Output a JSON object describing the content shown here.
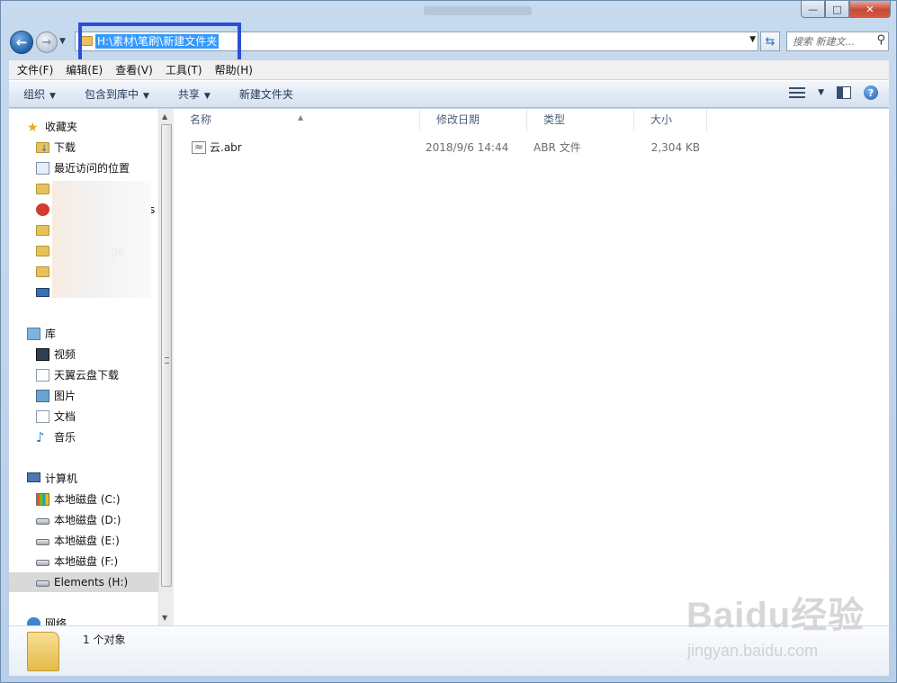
{
  "window": {
    "caption": {
      "minimize": "—",
      "maximize": "□",
      "close": "✕"
    }
  },
  "nav": {
    "back": "←",
    "forward": "→",
    "recent": "▼",
    "address": "H:\\素材\\笔刷\\新建文件夹",
    "address_dropdown": "▼",
    "refresh": "⇆",
    "search_placeholder": "搜索 新建文...",
    "search_icon": "⚲"
  },
  "menu": [
    "文件(F)",
    "编辑(E)",
    "查看(V)",
    "工具(T)",
    "帮助(H)"
  ],
  "toolbar": {
    "organize": "组织",
    "include_library": "包含到库中",
    "share": "共享",
    "new_folder": "新建文件夹",
    "dropdown_arrow": "▼",
    "help": "?"
  },
  "sidebar": {
    "favorites": "收藏夹",
    "favorites_items": [
      "下载",
      "最近访问的位置",
      "s",
      "ge"
    ],
    "libraries": "库",
    "library_items": [
      "视频",
      "天翼云盘下载",
      "图片",
      "文档",
      "音乐"
    ],
    "computer": "计算机",
    "computer_items": [
      "本地磁盘 (C:)",
      "本地磁盘 (D:)",
      "本地磁盘 (E:)",
      "本地磁盘 (F:)",
      "Elements (H:)"
    ],
    "network": "网络"
  },
  "columns": [
    "名称",
    "修改日期",
    "类型",
    "大小"
  ],
  "files": [
    {
      "name": "云.abr",
      "modified": "2018/9/6 14:44",
      "type": "ABR 文件",
      "size": "2,304 KB"
    }
  ],
  "status": {
    "count": "1 个对象"
  },
  "watermark": {
    "logo": "Baidu经验",
    "url": "jingyan.baidu.com"
  }
}
